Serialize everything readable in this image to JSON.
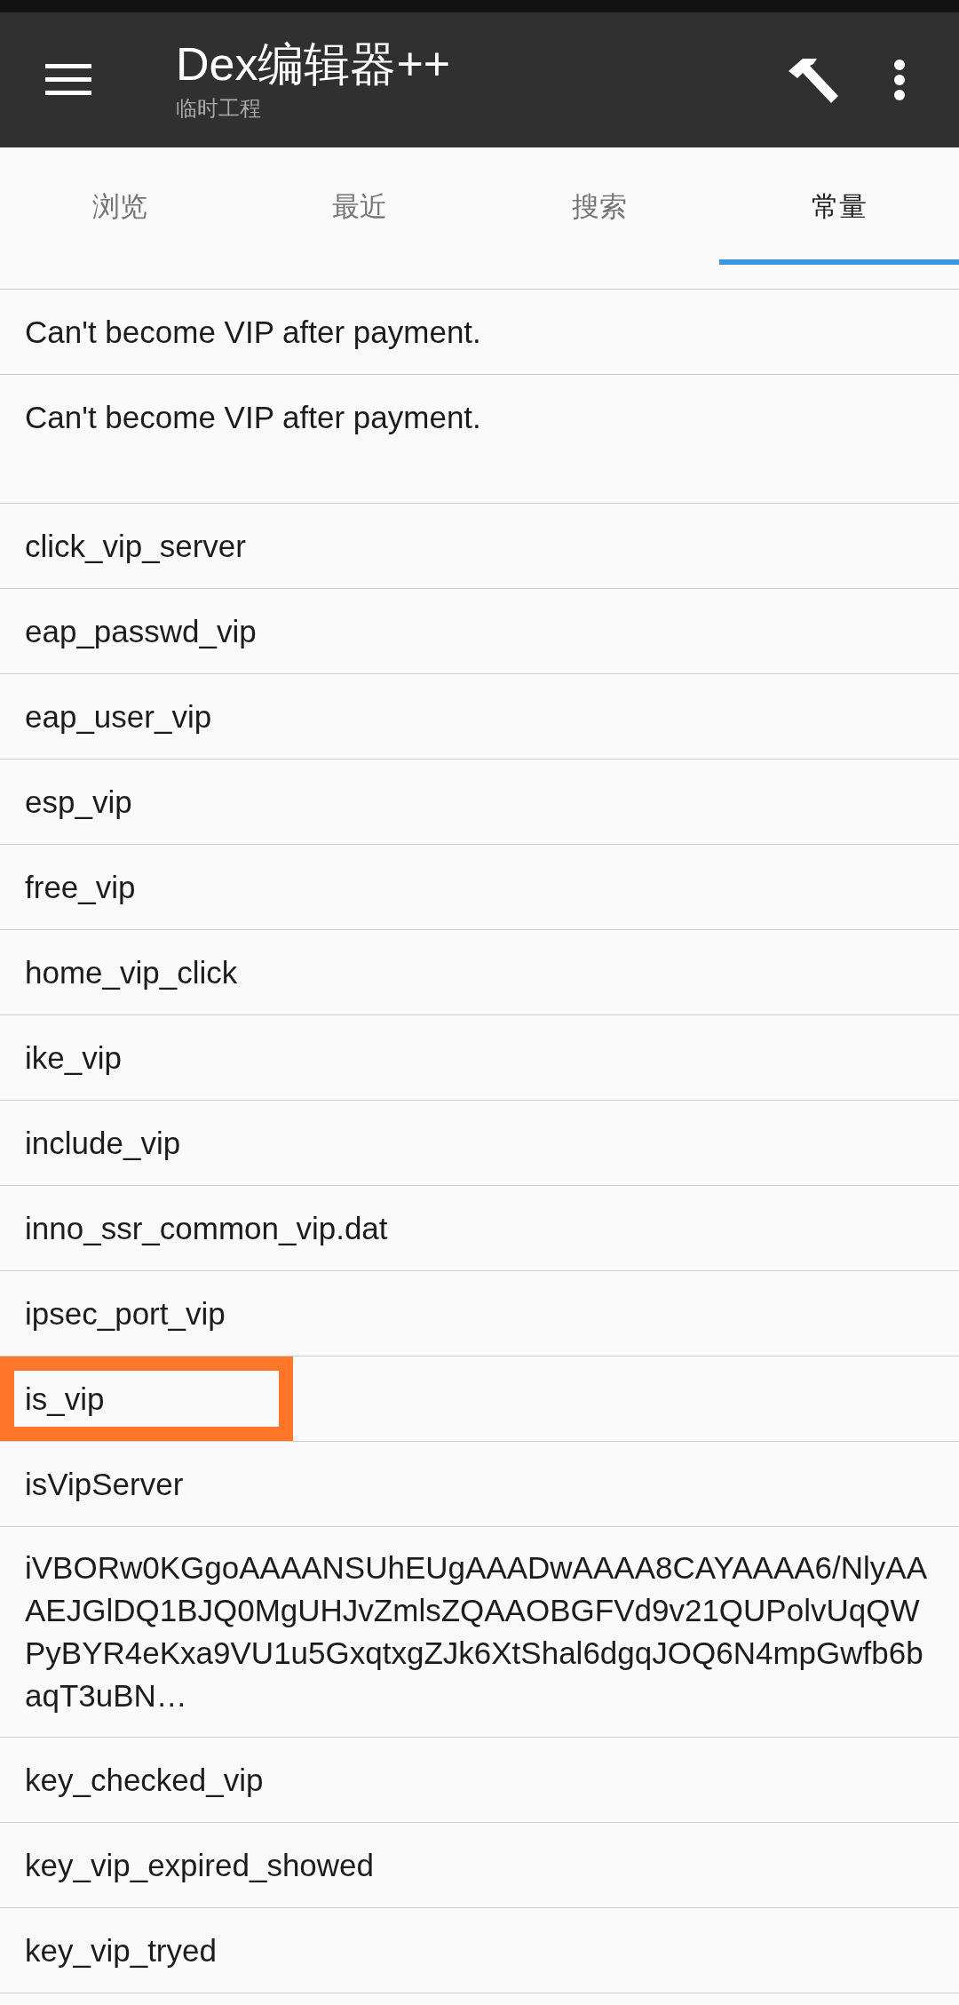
{
  "toolbar": {
    "title": "Dex编辑器++",
    "subtitle": "临时工程"
  },
  "tabs": [
    {
      "label": "浏览",
      "selected": false
    },
    {
      "label": "最近",
      "selected": false
    },
    {
      "label": "搜索",
      "selected": false
    },
    {
      "label": "常量",
      "selected": true
    }
  ],
  "constants": [
    {
      "text": "Can't become VIP after payment.",
      "kind": "plain",
      "highlighted": false
    },
    {
      "text": "Can't become VIP after payment.",
      "kind": "trailing_blank_line",
      "highlighted": false
    },
    {
      "text": "click_vip_server",
      "kind": "plain",
      "highlighted": false
    },
    {
      "text": "eap_passwd_vip",
      "kind": "plain",
      "highlighted": false
    },
    {
      "text": "eap_user_vip",
      "kind": "plain",
      "highlighted": false
    },
    {
      "text": "esp_vip",
      "kind": "plain",
      "highlighted": false
    },
    {
      "text": "free_vip",
      "kind": "plain",
      "highlighted": false
    },
    {
      "text": "home_vip_click",
      "kind": "plain",
      "highlighted": false
    },
    {
      "text": "ike_vip",
      "kind": "plain",
      "highlighted": false
    },
    {
      "text": "include_vip",
      "kind": "plain",
      "highlighted": false
    },
    {
      "text": "inno_ssr_common_vip.dat",
      "kind": "plain",
      "highlighted": false
    },
    {
      "text": "ipsec_port_vip",
      "kind": "plain",
      "highlighted": false
    },
    {
      "text": "is_vip",
      "kind": "plain",
      "highlighted": true
    },
    {
      "text": "isVipServer",
      "kind": "plain",
      "highlighted": false
    },
    {
      "text": "iVBORw0KGgoAAAANSUhEUgAAADwAAAA8CAYAAAA6/NlyAAAEJGlDQ1BJQ0MgUHJvZmlsZQAAOBGFVd9v21QUPolvUqQWPyBYR4eKxa9VU1u5GxqtxgZJk6XtShal6dgqJOQ6N4mpGwfb6baqT3uBN…",
      "kind": "plain",
      "highlighted": false
    },
    {
      "text": "key_checked_vip",
      "kind": "plain",
      "highlighted": false
    },
    {
      "text": "key_vip_expired_showed",
      "kind": "plain",
      "highlighted": false
    },
    {
      "text": "key_vip_tryed",
      "kind": "plain",
      "highlighted": false
    }
  ]
}
